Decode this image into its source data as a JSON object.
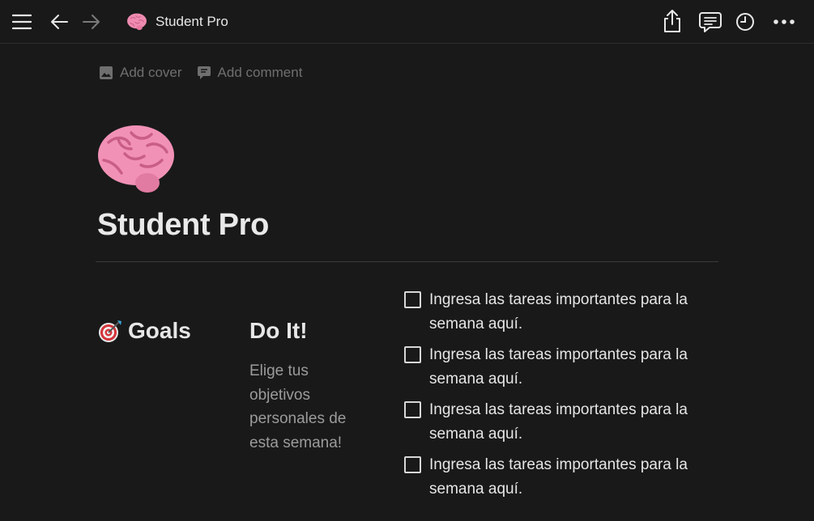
{
  "topbar": {
    "breadcrumb_title": "Student Pro",
    "icons": [
      "menu-icon",
      "arrow-left-icon",
      "arrow-right-icon",
      "brain-icon",
      "share-icon",
      "comments-icon",
      "clock-icon",
      "more-icon"
    ]
  },
  "page_actions": {
    "add_cover": "Add cover",
    "add_comment": "Add comment"
  },
  "page": {
    "title": "Student Pro",
    "icon": "brain-emoji"
  },
  "columns": {
    "goals_heading": "Goals",
    "doit_heading": "Do It!",
    "doit_text": "Elige tus objetivos personales de esta semana!"
  },
  "todos": [
    {
      "text": "Ingresa las tareas importantes para la semana aquí.",
      "checked": false
    },
    {
      "text": "Ingresa las tareas importantes para la semana aquí.",
      "checked": false
    },
    {
      "text": "Ingresa las tareas importantes para la semana aquí.",
      "checked": false
    },
    {
      "text": "Ingresa las tareas importantes para la semana aquí.",
      "checked": false
    }
  ],
  "colors": {
    "background": "#191919",
    "text": "#e6e6e6",
    "muted": "#6f6f6f",
    "brain_pink": "#f28fb4"
  }
}
